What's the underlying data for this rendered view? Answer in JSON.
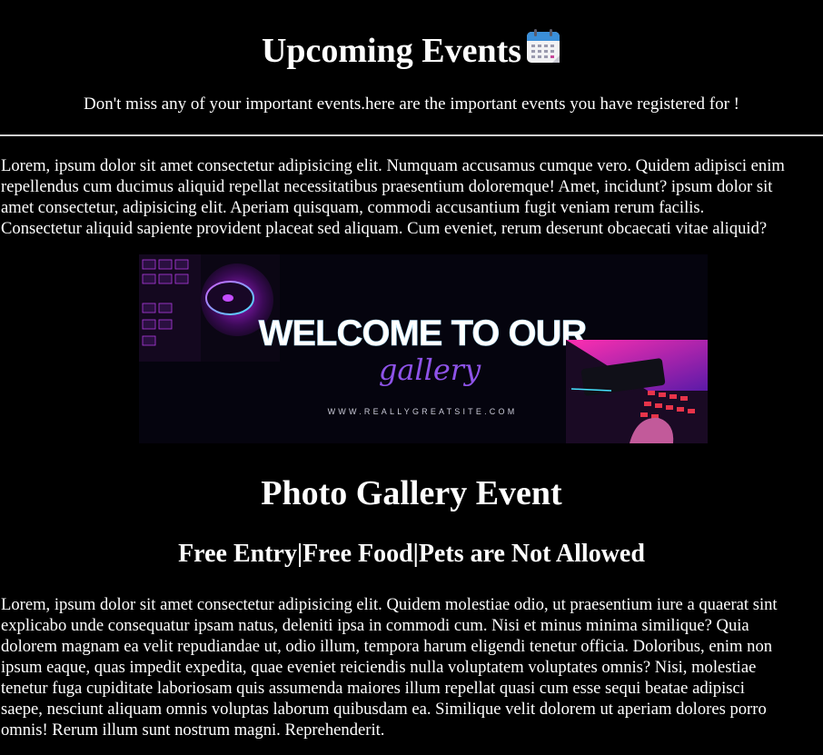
{
  "header": {
    "title": "Upcoming Events",
    "title_icon": "calendar-icon",
    "subtitle": "Don't miss any of your important events.here are the important events you have registered for !"
  },
  "intro": {
    "lines": [
      "Lorem, ipsum dolor sit amet consectetur adipisicing elit. Numquam accusamus cumque vero. Quidem adipisci enim",
      "repellendus cum ducimus aliquid repellat necessitatibus praesentium doloremque! Amet, incidunt? ipsum dolor sit",
      "amet consectetur, adipisicing elit. Aperiam quisquam, commodi accusantium fugit veniam rerum facilis.",
      "Consectetur aliquid sapiente provident placeat sed aliquam. Cum eveniet, rerum deserunt obcaecati vitae aliquid?"
    ]
  },
  "banner": {
    "headline": "WELCOME TO OUR",
    "script": "gallery",
    "website": "WWW.REALLYGREATSITE.COM",
    "colors": {
      "background": "#05040e",
      "accent_pink": "#ff2fb0",
      "accent_purple": "#9b5cff",
      "accent_cyan": "#46e3ff"
    }
  },
  "event": {
    "title": "Photo Gallery Event",
    "tagline": "Free Entry|Free Food|Pets are Not Allowed",
    "description_lines": [
      "Lorem, ipsum dolor sit amet consectetur adipisicing elit. Quidem molestiae odio, ut praesentium iure a quaerat sint",
      "explicabo unde consequatur ipsam natus, deleniti ipsa in commodi cum. Nisi et minus minima similique? Quia",
      "dolorem magnam ea velit repudiandae ut, odio illum, tempora harum eligendi tenetur officia. Doloribus, enim non",
      "ipsum eaque, quas impedit expedita, quae eveniet reiciendis nulla voluptatem voluptates omnis? Nisi, molestiae",
      "tenetur fuga cupiditate laboriosam quis assumenda maiores illum repellat quasi cum esse sequi beatae adipisci",
      "saepe, nesciunt aliquam omnis voluptas laborum quibusdam ea. Similique velit dolorem ut aperiam dolores porro",
      "omnis! Rerum illum sunt nostrum magni. Reprehenderit."
    ]
  }
}
